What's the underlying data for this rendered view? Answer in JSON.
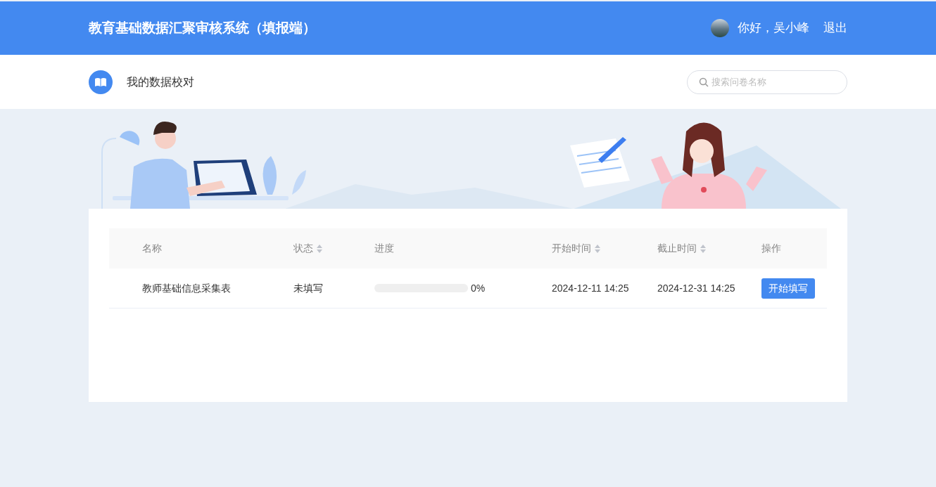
{
  "header": {
    "title": "教育基础数据汇聚审核系统（填报端）",
    "greeting": "你好，吴小峰",
    "logout": "退出"
  },
  "subheader": {
    "title": "我的数据校对",
    "search": {
      "placeholder": "搜索问卷名称"
    }
  },
  "table": {
    "columns": [
      {
        "label": "名称",
        "sortable": false
      },
      {
        "label": "状态",
        "sortable": true
      },
      {
        "label": "进度",
        "sortable": false
      },
      {
        "label": "开始时间",
        "sortable": true
      },
      {
        "label": "截止时间",
        "sortable": true
      },
      {
        "label": "操作",
        "sortable": false
      }
    ],
    "rows": [
      {
        "name": "教师基础信息采集表",
        "status": "未填写",
        "level": 0,
        "reading": "0%",
        "start": "2024-12-11 14:25",
        "end": "2024-12-31 14:25",
        "action": "开始填写"
      }
    ]
  }
}
